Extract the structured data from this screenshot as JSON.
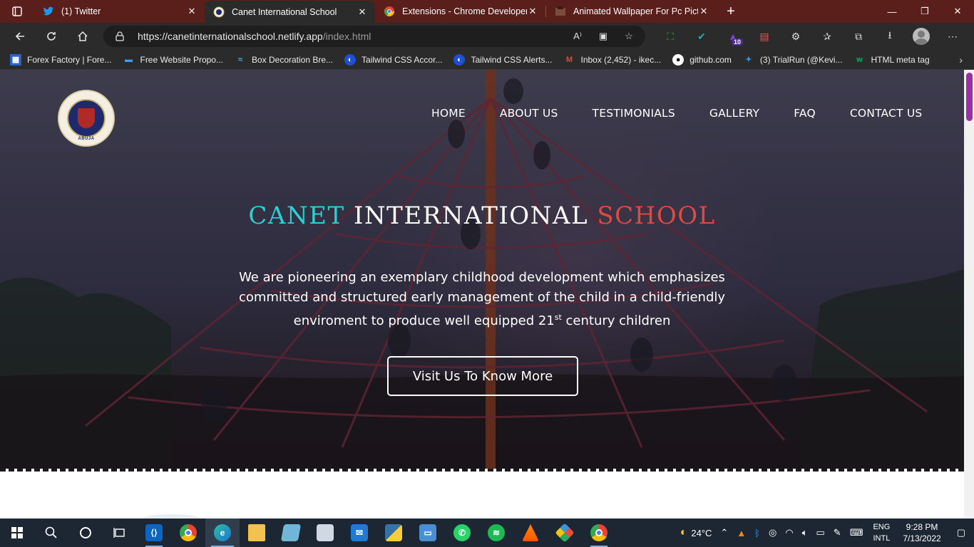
{
  "browser": {
    "tabs": [
      {
        "title": "(1) Twitter",
        "icon": "twitter-icon",
        "color": "#1d9bf0"
      },
      {
        "title": "Canet International School",
        "icon": "site-icon",
        "color": "#7a3b6e"
      },
      {
        "title": "Extensions - Chrome Developers",
        "icon": "chrome-icon",
        "color": "#e8453c"
      },
      {
        "title": "Animated Wallpaper For Pc Pictu",
        "icon": "wallpaper-icon",
        "color": "#7b4a3a"
      }
    ],
    "address": {
      "host": "https://canetinternationalschool.netlify.app",
      "path": "/index.html"
    },
    "extension_badge": "10",
    "bookmarks": [
      {
        "label": "Forex Factory | Fore...",
        "icon": "forex-icon"
      },
      {
        "label": "Free Website Propo...",
        "icon": "proposal-icon"
      },
      {
        "label": "Box Decoration Bre...",
        "icon": "tailwind-icon"
      },
      {
        "label": "Tailwind CSS Accor...",
        "icon": "tailwind-icon"
      },
      {
        "label": "Tailwind CSS Alerts...",
        "icon": "tailwind-icon"
      },
      {
        "label": "Inbox (2,452) - ikec...",
        "icon": "gmail-icon"
      },
      {
        "label": "github.com",
        "icon": "github-icon"
      },
      {
        "label": "(3) TrialRun (@Kevi...",
        "icon": "twitter-icon"
      },
      {
        "label": "HTML meta tag",
        "icon": "w3-icon"
      }
    ]
  },
  "site": {
    "logo": {
      "ring_bottom": "ABUJA"
    },
    "nav": [
      "HOME",
      "ABOUT US",
      "TESTIMONIALS",
      "GALLERY",
      "FAQ",
      "CONTACT US"
    ],
    "hero": {
      "title_word1": "CANET",
      "title_word2": "INTERNATIONAL",
      "title_word3": "SCHOOL",
      "tagline_part1": "We are pioneering an exemplary childhood development which emphasizes committed and structured early management of the child in a child-friendly enviroment to produce well equipped 21",
      "tagline_sup": "st",
      "tagline_part2": " century children",
      "cta_label": "Visit Us To Know More"
    },
    "colors": {
      "accent_cyan": "#2bd0d4",
      "accent_red": "#e04a3e"
    }
  },
  "taskbar": {
    "weather": "24°C",
    "lang_line1": "ENG",
    "lang_line2": "INTL",
    "time": "9:28 PM",
    "date": "7/13/2022"
  }
}
